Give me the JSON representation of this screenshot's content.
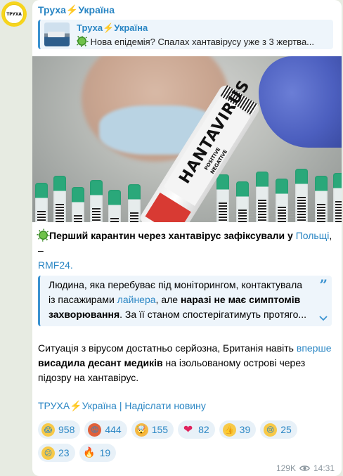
{
  "channel": {
    "avatar_text": "ТРУХА",
    "name": "Труха⚡Україна"
  },
  "reply": {
    "title": "Труха⚡Україна",
    "text": "Нова епідемія? Спалах хантавірусу уже з 3 жертва..."
  },
  "photo": {
    "vial_text": "HANTAVIRUS",
    "positive": "POSITIVE",
    "negative": "NEGATIVE"
  },
  "post": {
    "headline": "Перший карантин через хантавірус зафіксували у ",
    "headline_link": "Польщі",
    "headline_sep": ", – ",
    "source_link": "RMF24.",
    "quote_part1": "Людина, яка перебуває під моніторингом, контактувала із пасажирами ",
    "quote_link": "лайнера",
    "quote_part2": ", але ",
    "quote_bold": "наразі не має симптомів захворювання",
    "quote_part3": ". За її станом спостерігатимуть протяго...",
    "para_part1": "Ситуація з вірусом достатньо серйозна, Британія навіть ",
    "para_link": "вперше",
    "para_space": " ",
    "para_bold": "висадила десант медиків",
    "para_part2": " на ізольованому острові через підозру на хантавірус.",
    "footer": "ТРУХА⚡Україна | Надіслати новину"
  },
  "reactions": [
    {
      "emoji": "scream-emoji",
      "glyph": "😱",
      "count": "958",
      "bg": "#f7c948"
    },
    {
      "emoji": "rage-emoji",
      "glyph": "😡",
      "count": "444",
      "bg": "#e0603a"
    },
    {
      "emoji": "exploding-head-emoji",
      "glyph": "🤯",
      "count": "155",
      "bg": "#f5b843"
    },
    {
      "emoji": "heart-emoji",
      "glyph": "❤",
      "count": "82",
      "bg": "transparent"
    },
    {
      "emoji": "thumbs-up-emoji",
      "glyph": "👍",
      "count": "39",
      "bg": "#f7c948"
    },
    {
      "emoji": "sad-emoji",
      "glyph": "😢",
      "count": "25",
      "bg": "#f7c948"
    },
    {
      "emoji": "confused-emoji",
      "glyph": "😕",
      "count": "23",
      "bg": "#f7c948"
    },
    {
      "emoji": "fire-emoji",
      "glyph": "🔥",
      "count": "19",
      "bg": "transparent"
    }
  ],
  "meta": {
    "views": "129K",
    "time": "14:31"
  },
  "colors": {
    "link": "#2a86c4",
    "quote_bg": "#eef5fb",
    "accent": "#3a92d0"
  }
}
